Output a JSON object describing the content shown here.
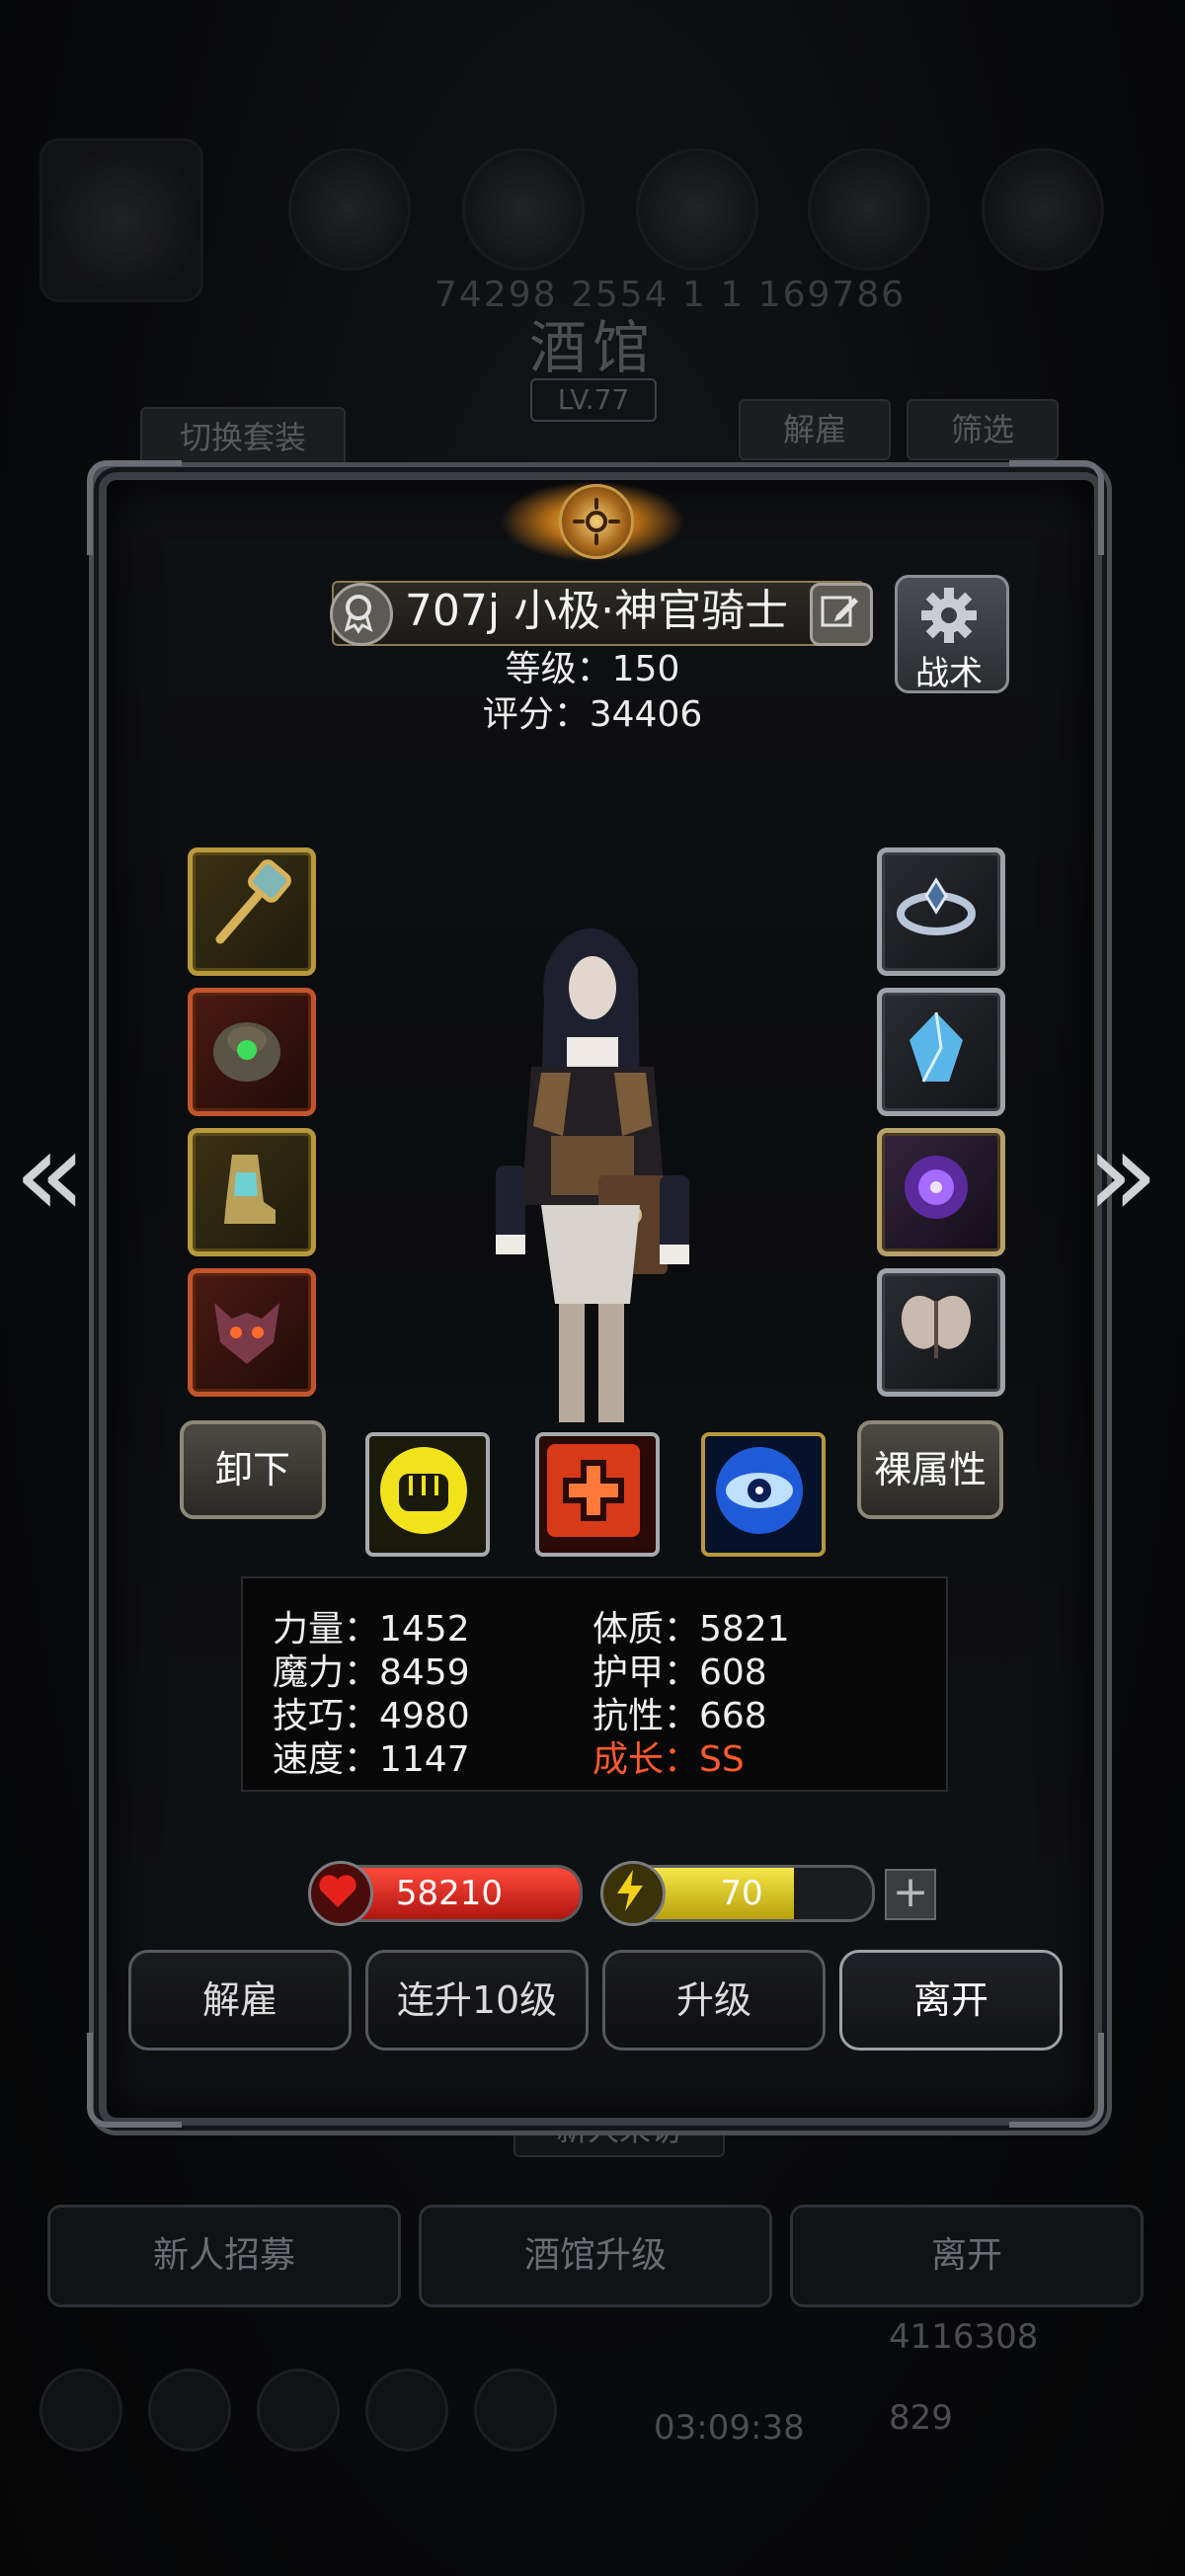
{
  "background": {
    "numbers": "74298   2554   1   1   169786",
    "title": "酒馆",
    "level": "LV.77",
    "switch_outfit": "切换套装",
    "dismiss": "解雇",
    "filter": "筛选",
    "new_visitor": "新人来访",
    "recruit": "新人招募",
    "tavern_upgrade": "酒馆升级",
    "leave": "离开",
    "gold": "4116308",
    "gems": "829",
    "timer": "03:09:38"
  },
  "hero": {
    "name": "707j 小极·神官骑士",
    "level_text": "等级：150",
    "score_text": "评分：34406",
    "tactics": "战术"
  },
  "equipment": {
    "left": [
      {
        "name": "golden-staff",
        "tier": "gold"
      },
      {
        "name": "green-gem-armor",
        "tier": "red"
      },
      {
        "name": "golden-boots",
        "tier": "gold"
      },
      {
        "name": "demon-helm",
        "tier": "red"
      }
    ],
    "right": [
      {
        "name": "silver-ring",
        "tier": "silver"
      },
      {
        "name": "blue-crystal",
        "tier": "silver"
      },
      {
        "name": "purple-orb",
        "tier": "purple"
      },
      {
        "name": "butterfly-wings",
        "tier": "silver"
      }
    ]
  },
  "actions": {
    "unequip": "卸下",
    "naked_attributes": "裸属性"
  },
  "skills": [
    {
      "name": "fist-skill-icon",
      "color": "#f2e21a"
    },
    {
      "name": "heal-cross-skill-icon",
      "color": "#e8451e"
    },
    {
      "name": "eye-skill-icon",
      "color": "#3a8cff"
    }
  ],
  "attributes": {
    "strength": "力量：1452",
    "constitution": "体质：5821",
    "magic": "魔力：8459",
    "armor": "护甲：608",
    "skill": "技巧：4980",
    "resistance": "抗性：668",
    "speed": "速度：1147",
    "growth": "成长：SS"
  },
  "bars": {
    "hp": "58210",
    "energy": "70",
    "energy_fraction": 0.7,
    "hp_fraction": 1.0,
    "plus": "+"
  },
  "buttons": {
    "dismiss": "解雇",
    "level10": "连升10级",
    "upgrade": "升级",
    "leave": "离开"
  },
  "colors": {
    "gold": "#b8983c",
    "red": "#c1542a",
    "growth": "#ff5a2c",
    "hp": "#d0201d",
    "energy": "#e5d21c"
  }
}
